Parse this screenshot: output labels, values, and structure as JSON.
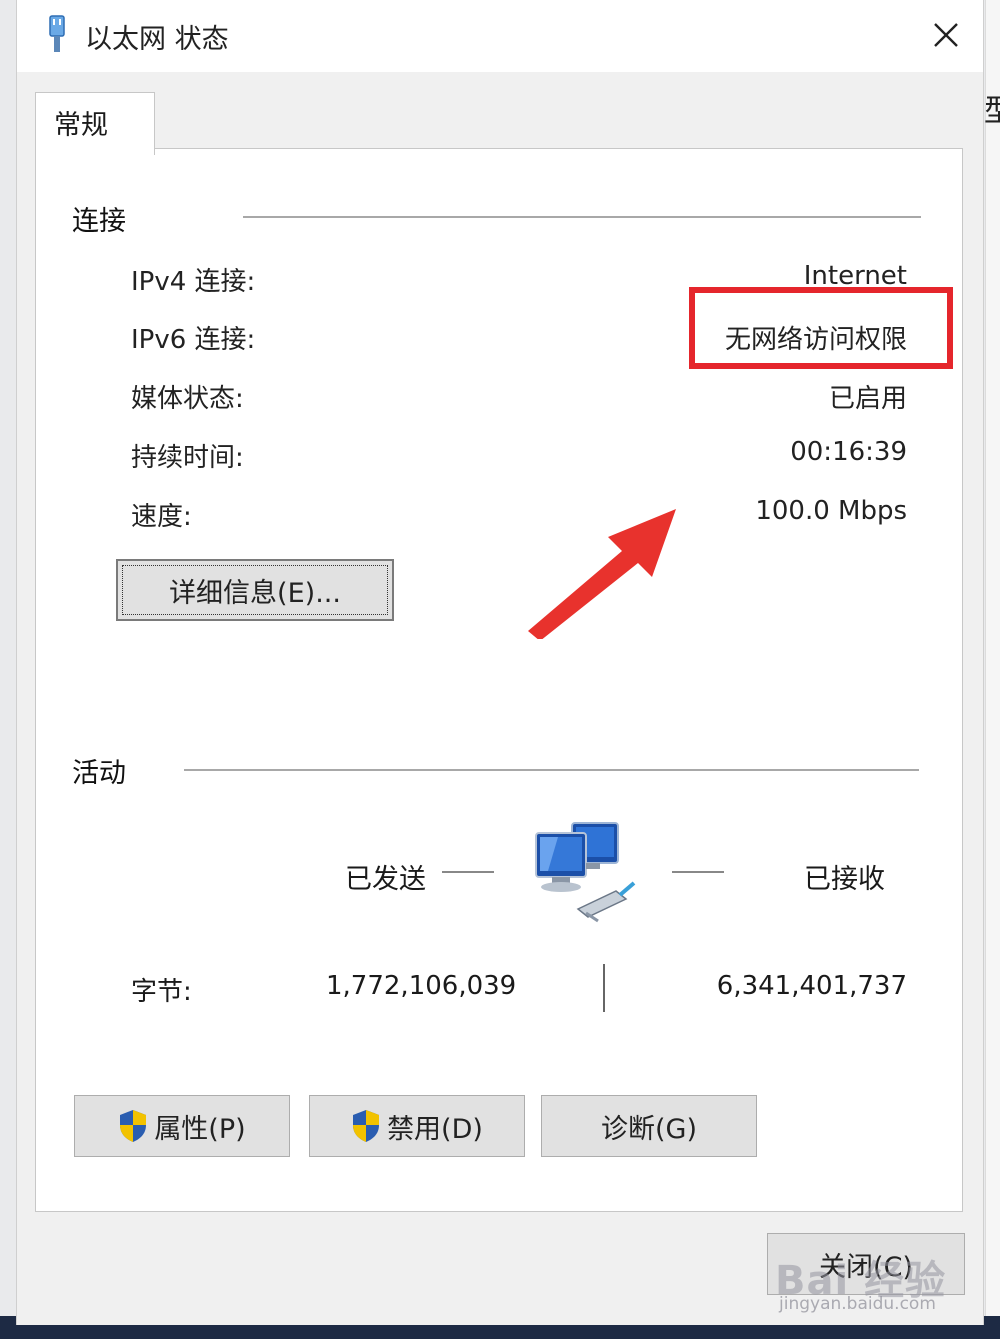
{
  "window": {
    "title": "以太网 状态",
    "close_glyph": "✕"
  },
  "background": {
    "edge_text": "型"
  },
  "tabs": [
    {
      "label": "常规"
    }
  ],
  "connection": {
    "group_label": "连接",
    "rows": [
      {
        "label": "IPv4 连接:",
        "value": "Internet"
      },
      {
        "label": "IPv6 连接:",
        "value": "无网络访问权限"
      },
      {
        "label": "媒体状态:",
        "value": "已启用"
      },
      {
        "label": "持续时间:",
        "value": "00:16:39"
      },
      {
        "label": "速度:",
        "value": "100.0 Mbps"
      }
    ],
    "details_button": "详细信息(E)..."
  },
  "activity": {
    "group_label": "活动",
    "sent_label": "已发送",
    "received_label": "已接收",
    "bytes_label": "字节:",
    "bytes_sent": "1,772,106,039",
    "bytes_received": "6,341,401,737"
  },
  "buttons": {
    "properties": "属性(P)",
    "disable": "禁用(D)",
    "diagnose": "诊断(G)",
    "close": "关闭(C)"
  },
  "watermark": {
    "main": "Bai 经验",
    "sub": "jingyan.baidu.com"
  },
  "colors": {
    "highlight": "#e5262c",
    "arrow": "#e8322d",
    "shield_blue": "#2a5db0",
    "shield_yellow": "#f2c200"
  },
  "icons": [
    "ethernet-icon",
    "close-icon",
    "network-computers-icon",
    "shield-icon",
    "red-arrow"
  ]
}
